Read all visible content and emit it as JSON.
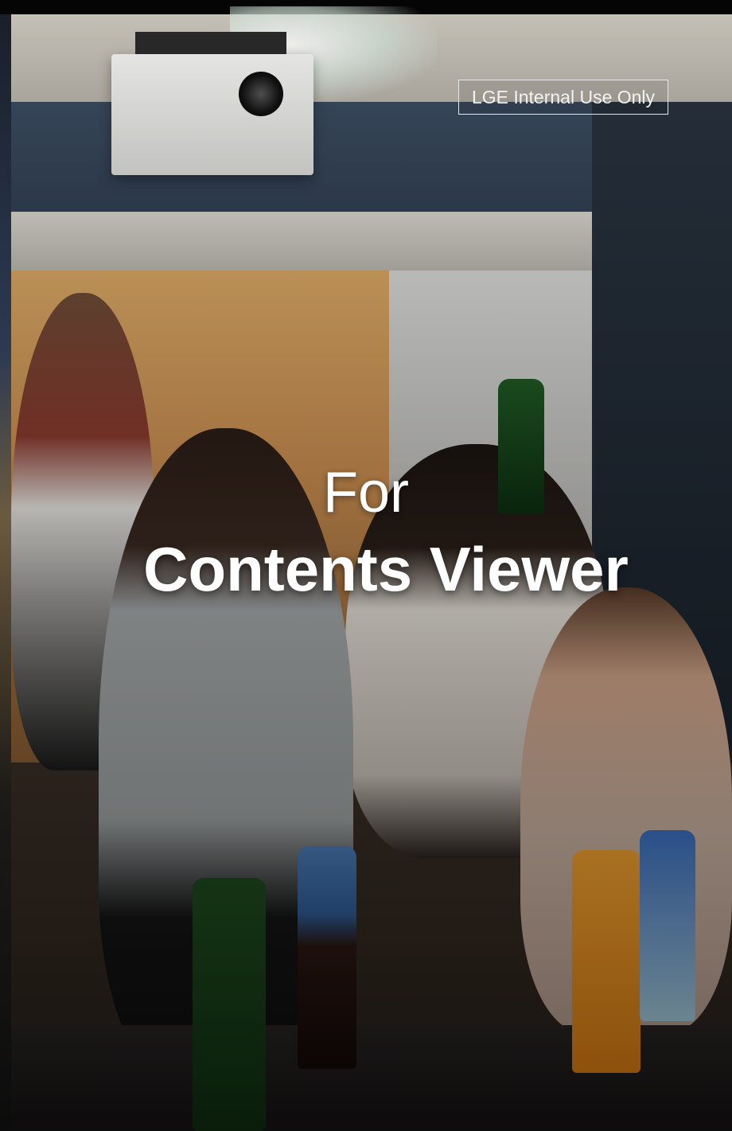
{
  "badge": {
    "label": "LGE Internal Use Only"
  },
  "hero": {
    "pre_title": "For",
    "title": "Contents Viewer"
  },
  "background": {
    "image": "party-with-projector-photo"
  }
}
